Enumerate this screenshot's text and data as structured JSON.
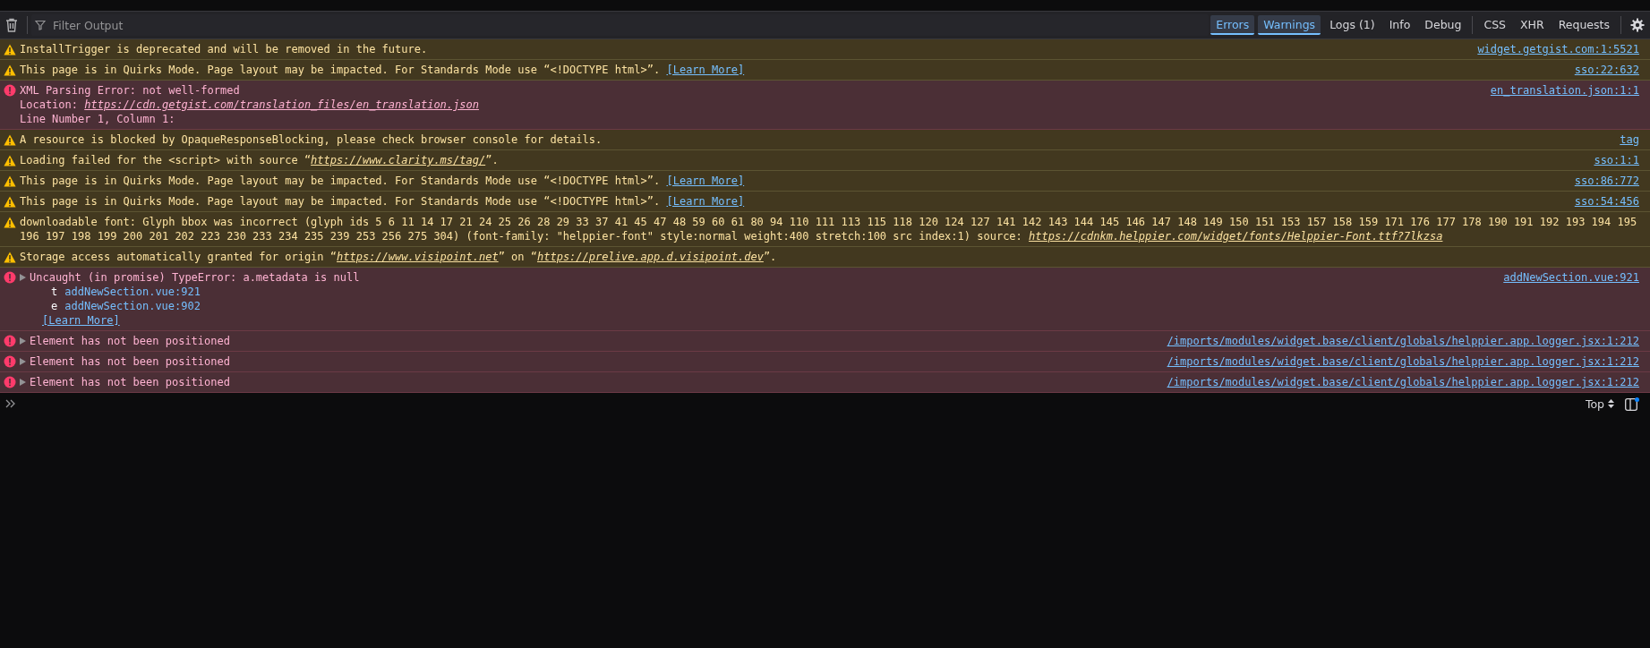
{
  "toolbar": {
    "filter_placeholder": "Filter Output",
    "levels": [
      {
        "label": "Errors",
        "selected": true
      },
      {
        "label": "Warnings",
        "selected": true
      },
      {
        "label": "Logs (1)",
        "selected": false
      },
      {
        "label": "Info",
        "selected": false
      },
      {
        "label": "Debug",
        "selected": false
      }
    ],
    "network": [
      {
        "label": "CSS",
        "selected": false
      },
      {
        "label": "XHR",
        "selected": false
      },
      {
        "label": "Requests",
        "selected": false
      }
    ]
  },
  "messages": [
    {
      "kind": "warning",
      "expandable": false,
      "source": "widget.getgist.com:1:5521",
      "lines": [
        [
          {
            "kind": "text",
            "text": "InstallTrigger is deprecated and will be removed in the future."
          }
        ]
      ]
    },
    {
      "kind": "warning",
      "expandable": false,
      "source": "sso:22:632",
      "lines": [
        [
          {
            "kind": "text",
            "text": "This page is in Quirks Mode. Page layout may be impacted. For Standards Mode use “<!DOCTYPE html>”. "
          },
          {
            "kind": "link",
            "text": "[Learn More]"
          }
        ]
      ]
    },
    {
      "kind": "error",
      "expandable": false,
      "source": "en_translation.json:1:1",
      "lines": [
        [
          {
            "kind": "text",
            "text": "XML Parsing Error: not well-formed"
          }
        ],
        [
          {
            "kind": "text",
            "text": "Location: "
          },
          {
            "kind": "url",
            "text": "https://cdn.getgist.com/translation_files/en_translation.json"
          }
        ],
        [
          {
            "kind": "text",
            "text": "Line Number 1, Column 1:"
          }
        ]
      ]
    },
    {
      "kind": "warning",
      "expandable": false,
      "source": "tag",
      "lines": [
        [
          {
            "kind": "text",
            "text": "A resource is blocked by OpaqueResponseBlocking, please check browser console for details."
          }
        ]
      ]
    },
    {
      "kind": "warning",
      "expandable": false,
      "source": "sso:1:1",
      "lines": [
        [
          {
            "kind": "text",
            "text": "Loading failed for the <script> with source “"
          },
          {
            "kind": "url",
            "text": "https://www.clarity.ms/tag/"
          },
          {
            "kind": "text",
            "text": "”."
          }
        ]
      ]
    },
    {
      "kind": "warning",
      "expandable": false,
      "source": "sso:86:772",
      "lines": [
        [
          {
            "kind": "text",
            "text": "This page is in Quirks Mode. Page layout may be impacted. For Standards Mode use “<!DOCTYPE html>”. "
          },
          {
            "kind": "link",
            "text": "[Learn More]"
          }
        ]
      ]
    },
    {
      "kind": "warning",
      "expandable": false,
      "source": "sso:54:456",
      "lines": [
        [
          {
            "kind": "text",
            "text": "This page is in Quirks Mode. Page layout may be impacted. For Standards Mode use “<!DOCTYPE html>”. "
          },
          {
            "kind": "link",
            "text": "[Learn More]"
          }
        ]
      ]
    },
    {
      "kind": "warning",
      "expandable": false,
      "lines": [
        [
          {
            "kind": "text",
            "text": "downloadable font: Glyph bbox was incorrect (glyph ids 5 6 11 14 17 21 24 25 26 28 29 33 37 41 45 47 48 59 60 61 80 94 110 111 113 115 118 120 124 127 141 142 143 144 145 146 147 148 149 150 151 153 157 158 159 171 176 177 178 190 191 192 193 194 195 196 197 198 199 200 201 202 223 230 233 234 235 239 253 256 275 304) (font-family: \"helppier-font\" style:normal weight:400 stretch:100 src index:1) source: "
          },
          {
            "kind": "url",
            "text": "https://cdnkm.helppier.com/widget/fonts/Helppier-Font.ttf?7lkzsa"
          }
        ]
      ]
    },
    {
      "kind": "warning",
      "expandable": false,
      "lines": [
        [
          {
            "kind": "text",
            "text": "Storage access automatically granted for origin “"
          },
          {
            "kind": "url",
            "text": "https://www.visipoint.net"
          },
          {
            "kind": "text",
            "text": "” on “"
          },
          {
            "kind": "url",
            "text": "https://prelive.app.d.visipoint.dev"
          },
          {
            "kind": "text",
            "text": "”."
          }
        ]
      ]
    },
    {
      "kind": "error",
      "expandable": true,
      "source": "addNewSection.vue:921",
      "lines": [
        [
          {
            "kind": "text",
            "text": "Uncaught (in promise) TypeError: a.metadata is null"
          }
        ],
        [
          {
            "kind": "frame",
            "text": "t"
          },
          {
            "kind": "frame_link",
            "text": "addNewSection.vue:921"
          }
        ],
        [
          {
            "kind": "frame",
            "text": "e"
          },
          {
            "kind": "frame_link",
            "text": "addNewSection.vue:902"
          }
        ],
        [
          {
            "kind": "link",
            "text": "[Learn More]"
          }
        ]
      ]
    },
    {
      "kind": "error",
      "expandable": true,
      "source": "/imports/modules/widget.base/client/globals/helppier.app.logger.jsx:1:212",
      "lines": [
        [
          {
            "kind": "text",
            "text": "Element has not been positioned"
          }
        ]
      ]
    },
    {
      "kind": "error",
      "expandable": true,
      "source": "/imports/modules/widget.base/client/globals/helppier.app.logger.jsx:1:212",
      "lines": [
        [
          {
            "kind": "text",
            "text": "Element has not been positioned"
          }
        ]
      ]
    },
    {
      "kind": "error",
      "expandable": true,
      "source": "/imports/modules/widget.base/client/globals/helppier.app.logger.jsx:1:212",
      "lines": [
        [
          {
            "kind": "text",
            "text": "Element has not been positioned"
          }
        ]
      ]
    }
  ],
  "input": {
    "context": "Top"
  }
}
